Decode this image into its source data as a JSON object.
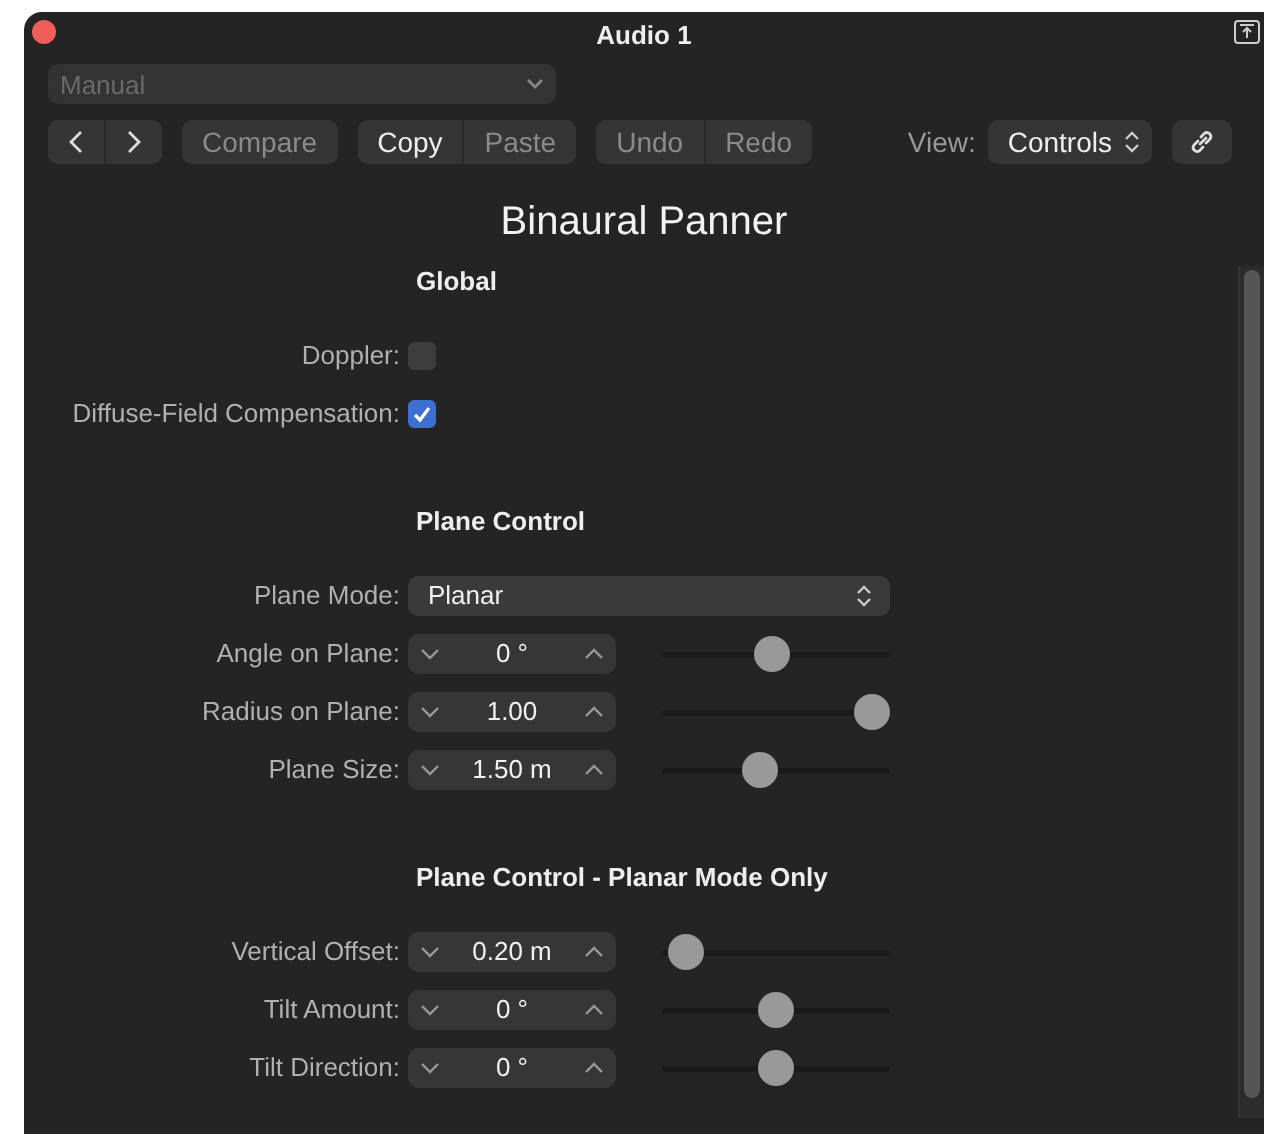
{
  "window": {
    "title": "Audio 1"
  },
  "preset": {
    "value": "Manual",
    "disabled": true
  },
  "toolbar": {
    "button_groups": [
      [
        {
          "label": "Compare",
          "disabled": true
        }
      ],
      [
        {
          "label": "Copy",
          "disabled": false
        },
        {
          "label": "Paste",
          "disabled": true
        }
      ],
      [
        {
          "label": "Undo",
          "disabled": true
        },
        {
          "label": "Redo",
          "disabled": true
        }
      ]
    ],
    "view_label": "View:",
    "view_value": "Controls"
  },
  "plugin_title": "Binaural Panner",
  "sections": [
    {
      "title": "Global",
      "rows": [
        {
          "kind": "checkbox",
          "label": "Doppler:",
          "checked": false
        },
        {
          "kind": "checkbox",
          "label": "Diffuse-Field Compensation:",
          "checked": true
        }
      ]
    },
    {
      "title": "Plane Control",
      "rows": [
        {
          "kind": "select",
          "label": "Plane Mode:",
          "value": "Planar"
        },
        {
          "kind": "stepper",
          "label": "Angle on Plane:",
          "value": "0 °",
          "level": 0.48
        },
        {
          "kind": "stepper",
          "label": "Radius on Plane:",
          "value": "1.00",
          "level": 1
        },
        {
          "kind": "stepper",
          "label": "Plane Size:",
          "value": "1.50 m",
          "level": 0.42
        }
      ]
    },
    {
      "title": "Plane Control - Planar Mode Only",
      "rows": [
        {
          "kind": "stepper",
          "label": "Vertical Offset:",
          "value": "0.20 m",
          "level": 0.03
        },
        {
          "kind": "stepper",
          "label": "Tilt Amount:",
          "value": "0 °",
          "level": 0.5
        },
        {
          "kind": "stepper",
          "label": "Tilt Direction:",
          "value": "0 °",
          "level": 0.5
        }
      ]
    }
  ]
}
